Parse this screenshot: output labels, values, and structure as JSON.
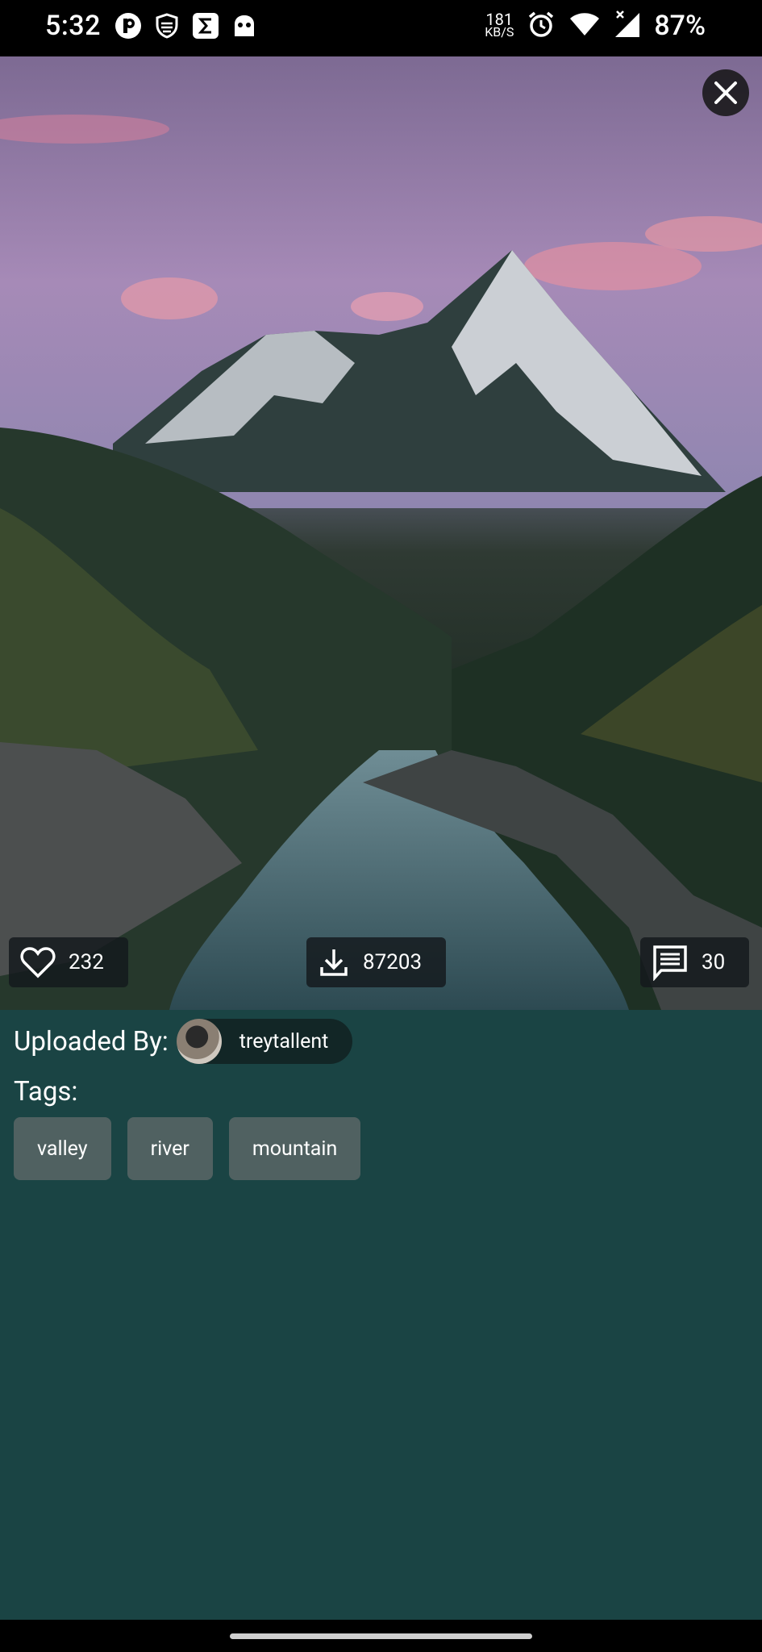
{
  "status_bar": {
    "time": "5:32",
    "left_icons": [
      "p-app-icon",
      "shield-icon",
      "sigma-app-icon",
      "ghost-icon"
    ],
    "speed_value": "181",
    "speed_unit": "KB/S",
    "right_icons": [
      "alarm-icon",
      "wifi-icon",
      "signal-icon"
    ],
    "battery": "87%"
  },
  "photo": {
    "subject": "mountain valley with river at dusk",
    "close_icon": "close-icon"
  },
  "stats": {
    "likes": "232",
    "downloads": "87203",
    "comments": "30"
  },
  "uploader": {
    "label": "Uploaded By:",
    "username": "treytallent"
  },
  "tags": {
    "label": "Tags:",
    "items": [
      "valley",
      "river",
      "mountain"
    ]
  },
  "colors": {
    "panel": "#1a4444",
    "chip": "#122626",
    "tag": "#506161"
  }
}
